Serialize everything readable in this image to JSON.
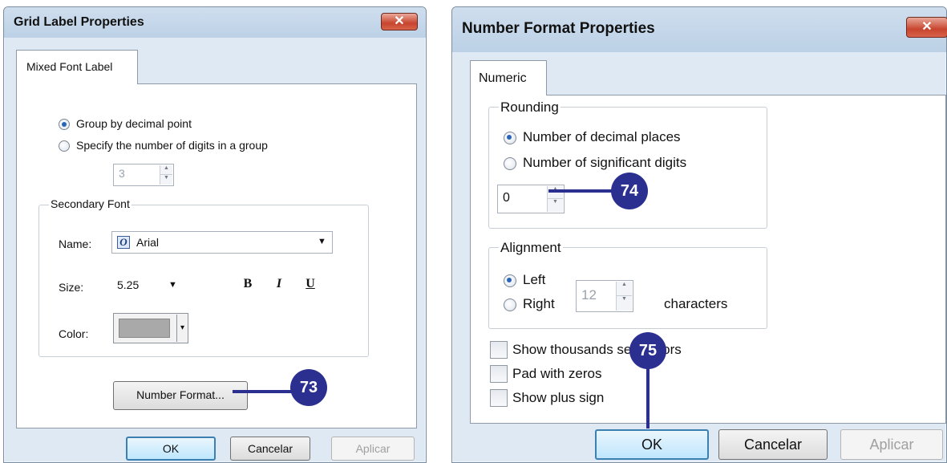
{
  "left_dialog": {
    "title": "Grid Label Properties",
    "close_glyph": "✕",
    "tab": "Mixed Font Label",
    "group_by_decimal": "Group by decimal point",
    "specify_digits": "Specify the number of digits in a group",
    "digits_value": "3",
    "secondary_font": {
      "legend": "Secondary Font",
      "name_label": "Name:",
      "name_value": "Arial",
      "font_icon": "opentype-font-icon",
      "size_label": "Size:",
      "size_value": "5.25",
      "bold": "B",
      "italic": "I",
      "underline": "U",
      "color_label": "Color:",
      "color_value": "#a9a9a9"
    },
    "number_format_button": "Number Format...",
    "ok": "OK",
    "cancel": "Cancelar",
    "apply": "Aplicar"
  },
  "right_dialog": {
    "title": "Number Format Properties",
    "close_glyph": "✕",
    "tab": "Numeric",
    "rounding": {
      "legend": "Rounding",
      "decimal_places": "Number of decimal places",
      "significant_digits": "Number of significant digits",
      "value": "0"
    },
    "alignment": {
      "legend": "Alignment",
      "left": "Left",
      "right": "Right",
      "characters_value": "12",
      "characters_label": "characters"
    },
    "show_thousands": "Show thousands separators",
    "pad_zeros": "Pad with zeros",
    "show_plus": "Show plus sign",
    "ok": "OK",
    "cancel": "Cancelar",
    "apply": "Aplicar"
  },
  "callouts": [
    "73",
    "74",
    "75"
  ],
  "colors": {
    "callout": "#2b2f8f",
    "title_bar": "#c4d7ea"
  }
}
